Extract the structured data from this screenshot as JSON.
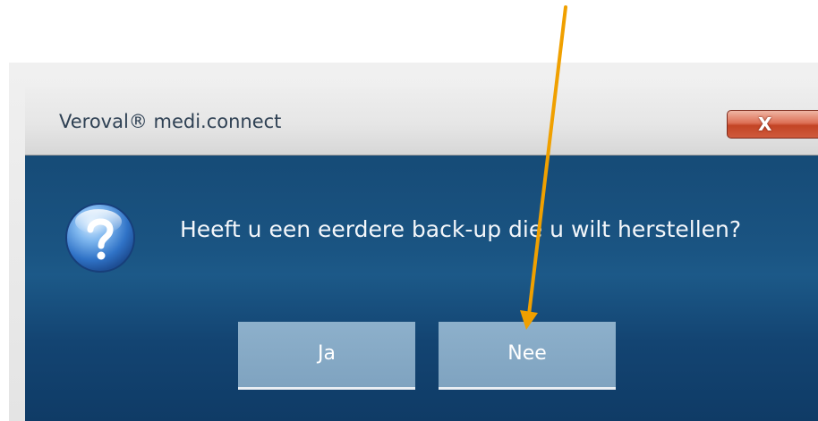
{
  "dialog": {
    "title": "Veroval® medi.connect",
    "close_label": "X",
    "message": "Heeft u een eerdere back-up die u wilt herstellen?",
    "icon": "question-icon",
    "buttons": {
      "yes_label": "Ja",
      "no_label": "Nee"
    }
  },
  "annotation": {
    "type": "arrow",
    "color": "#f0a000",
    "points_to": "no-button"
  }
}
